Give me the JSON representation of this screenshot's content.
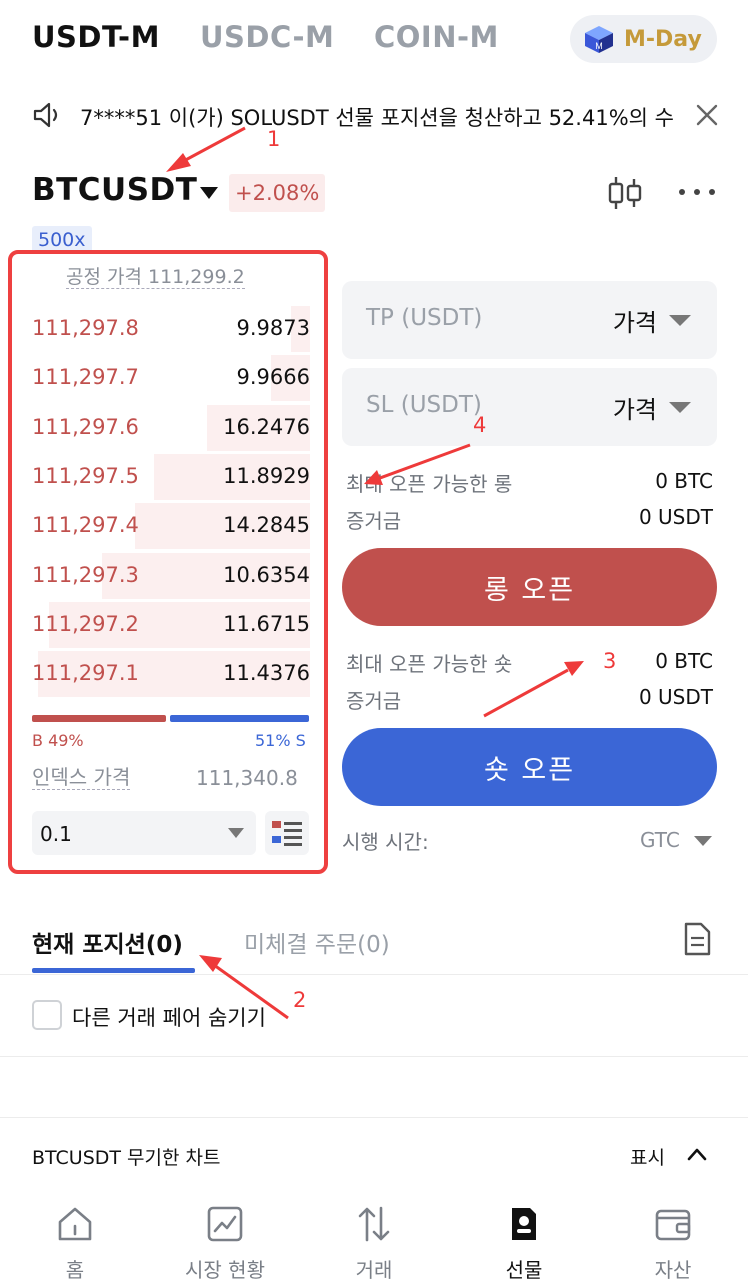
{
  "top_tabs": {
    "usdt_m": "USDT-M",
    "usdc_m": "USDC-M",
    "coin_m": "COIN-M"
  },
  "mday_label": "M-Day",
  "ticker": {
    "text": "7****51 이(가) SOLUSDT 선물 포지션을 청산하고 52.41%의 수"
  },
  "symbol": {
    "name": "BTCUSDT",
    "change": "+2.08%",
    "leverage": "500x"
  },
  "orderbook": {
    "fair_price_label": "공정 가격 111,299.2",
    "asks": [
      {
        "price": "111,297.8",
        "qty": "9.9873",
        "depth": 0.07
      },
      {
        "price": "111,297.7",
        "qty": "9.9666",
        "depth": 0.14
      },
      {
        "price": "111,297.6",
        "qty": "16.2476",
        "depth": 0.37
      },
      {
        "price": "111,297.5",
        "qty": "11.8929",
        "depth": 0.56
      },
      {
        "price": "111,297.4",
        "qty": "14.2845",
        "depth": 0.63
      },
      {
        "price": "111,297.3",
        "qty": "10.6354",
        "depth": 0.75
      },
      {
        "price": "111,297.2",
        "qty": "11.6715",
        "depth": 0.94
      },
      {
        "price": "111,297.1",
        "qty": "11.4376",
        "depth": 0.98
      }
    ],
    "ratio_buy": "B 49%",
    "ratio_sell": "51% S",
    "buy_fraction": 0.49,
    "index_label": "인덱스 가격",
    "index_value": "111,340.8",
    "precision": "0.1"
  },
  "order_form": {
    "tp_placeholder": "TP (USDT)",
    "tp_type": "가격",
    "sl_placeholder": "SL (USDT)",
    "sl_type": "가격",
    "max_long_label": "최대 오픈 가능한 롱",
    "max_long_value": "0 BTC",
    "margin_label_1": "증거금",
    "margin_value_1": "0 USDT",
    "long_button": "롱 오픈",
    "max_short_label": "최대 오픈 가능한 숏",
    "max_short_value": "0 BTC",
    "margin_label_2": "증거금",
    "margin_value_2": "0 USDT",
    "short_button": "숏 오픈",
    "tif_label": "시행 시간:",
    "tif_value": "GTC"
  },
  "positions": {
    "tab_current": "현재 포지션(0)",
    "tab_open_orders": "미체결 주문(0)",
    "hide_other_pairs": "다른 거래 페어 숨기기"
  },
  "chart_section": {
    "title": "BTCUSDT 무기한 차트",
    "toggle": "표시"
  },
  "bottom_nav": [
    {
      "label": "홈",
      "icon": "home-icon"
    },
    {
      "label": "시장 현황",
      "icon": "market-chart-icon"
    },
    {
      "label": "거래",
      "icon": "trade-arrows-icon"
    },
    {
      "label": "선물",
      "icon": "futures-icon"
    },
    {
      "label": "자산",
      "icon": "wallet-icon"
    }
  ],
  "annotations": [
    "1",
    "2",
    "3",
    "4"
  ],
  "colors": {
    "red": "#c0504d",
    "blue": "#3b66d6",
    "annotation": "#ee3a3a"
  }
}
